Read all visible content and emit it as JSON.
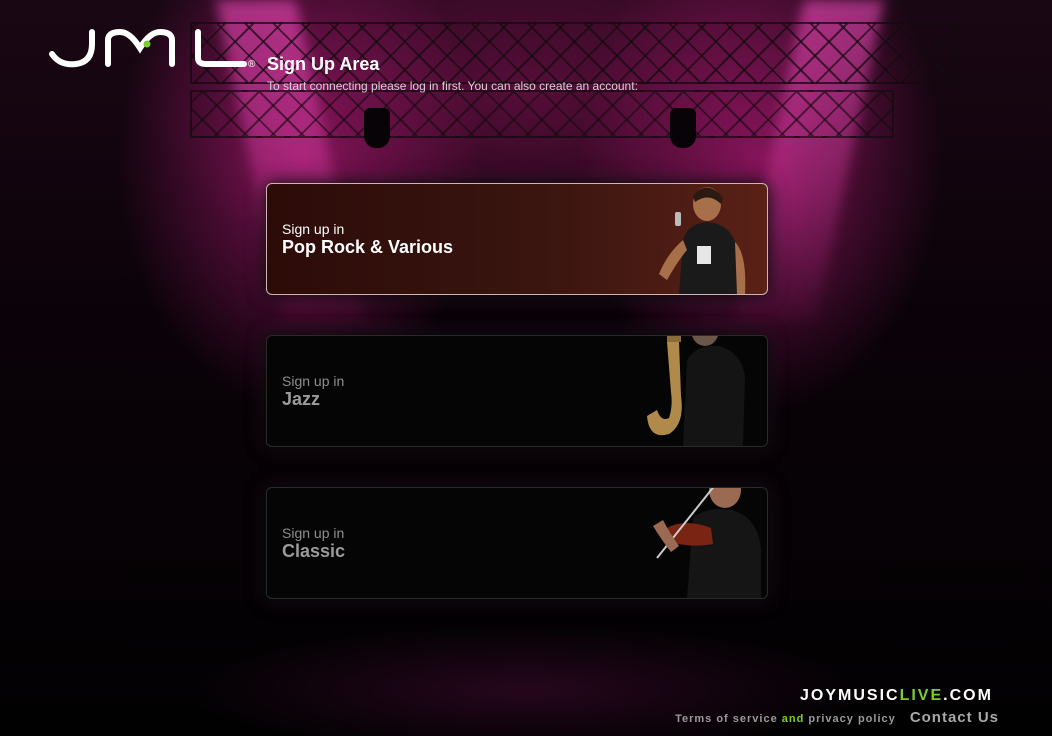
{
  "brand": {
    "logo_text": "JML",
    "registered_mark": "®",
    "site_name_main": "JOYMUSIC",
    "site_name_accent": "LIVE",
    "site_name_tld": ".COM",
    "accent_color": "#7dcc2d"
  },
  "header": {
    "title": "Sign Up Area",
    "subtitle": "To start connecting please log in first. You can also create an account:"
  },
  "cards": [
    {
      "prefix": "Sign up in",
      "genre": "Pop Rock & Various",
      "state": "active",
      "image": "singer-with-microphone"
    },
    {
      "prefix": "Sign up in",
      "genre": "Jazz",
      "state": "inactive",
      "image": "saxophone-player"
    },
    {
      "prefix": "Sign up in",
      "genre": "Classic",
      "state": "inactive",
      "image": "violin-player"
    }
  ],
  "footer": {
    "terms": "Terms of service",
    "and": "and",
    "privacy": "privacy policy",
    "contact": "Contact Us"
  }
}
